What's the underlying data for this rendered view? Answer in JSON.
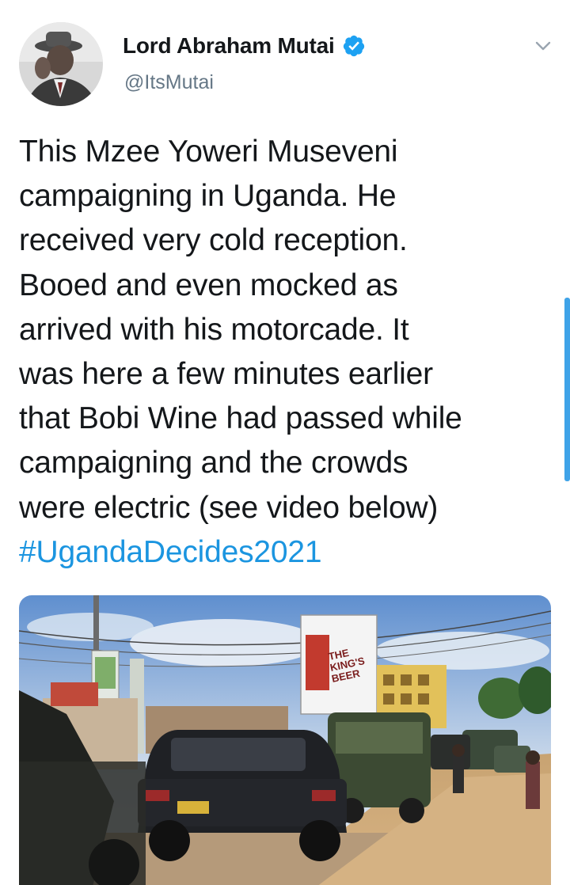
{
  "author": {
    "display_name": "Lord Abraham Mutai",
    "handle": "@ItsMutai",
    "verified": true,
    "avatar_icon": "profile-photo"
  },
  "tweet": {
    "lines": [
      "This Mzee Yoweri Museveni",
      "campaigning in Uganda. He",
      "received very cold reception.",
      "Booed and even mocked as",
      "arrived with his motorcade. It",
      "was here a few minutes earlier",
      "that Bobi Wine had passed while",
      "campaigning and the crowds",
      "were electric (see video below)"
    ],
    "hashtag": "#UgandaDecides2021"
  },
  "media": {
    "type": "video-thumbnail",
    "billboard_text": [
      "THE",
      "KING'S",
      "BEER"
    ]
  },
  "icons": {
    "verified": "verified-badge-icon",
    "more": "chevron-down-icon"
  },
  "colors": {
    "text": "#14171a",
    "secondary": "#657786",
    "link": "#1b95e0",
    "verified": "#1da1f2",
    "scrollbar": "#3fa3e8"
  }
}
